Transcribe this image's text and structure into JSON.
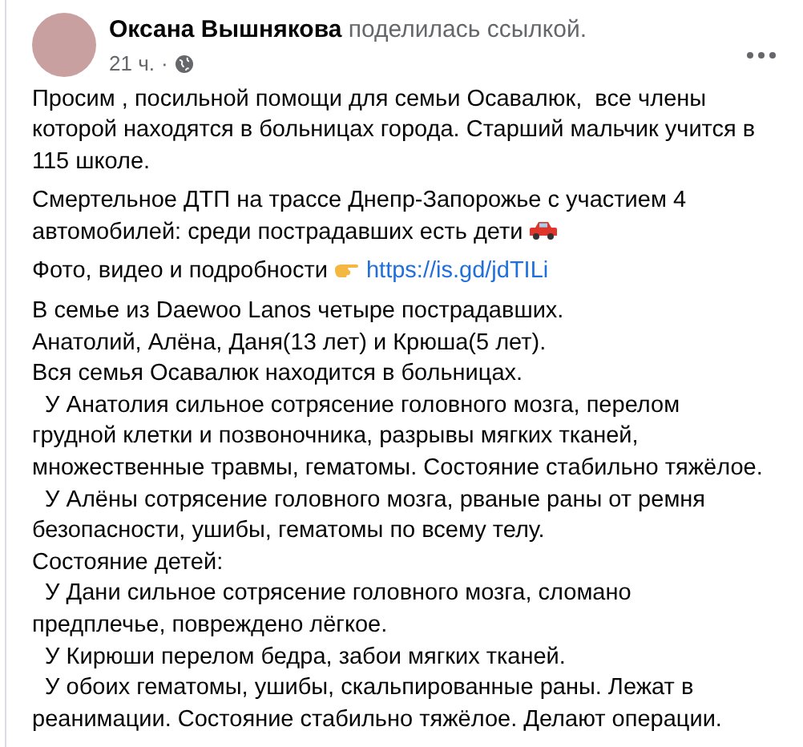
{
  "post": {
    "author": "Оксана Вышнякова",
    "action": "поделилась ссылкой.",
    "time": "21 ч.",
    "separator": "·",
    "paragraphs": [
      {
        "kind": "text",
        "lines": [
          "Просим , посильной помощи для семьи Осавалюк,  все члены",
          "которой находятся в больницах города. Старший мальчик учится в",
          "115 школе."
        ]
      },
      {
        "kind": "car",
        "lines": [
          "Смертельное ДТП на трассе Днепр-Запорожье с участием 4",
          "автомобилей: среди пострадавших есть дети"
        ]
      },
      {
        "kind": "link",
        "text": "Фото, видео и подробности",
        "url": "https://is.gd/jdTILi"
      },
      {
        "kind": "text",
        "lines": [
          "В семье из Daewoo Lanos четыре пострадавших.",
          "Анатолий, Алёна, Даня(13 лет) и Крюша(5 лет).",
          "Вся семья Осавалюк находится в больницах.",
          "  У Анатолия сильное сотрясение головного мозга, перелом",
          "грудной клетки и позвоночника, разрывы мягких тканей,",
          "множественные травмы, гематомы. Состояние стабильно тяжёлое.",
          "  У Алёны сотрясение головного мозга, рваные раны от ремня",
          "безопасности, ушибы, гематомы по всему телу.",
          "Состояние детей:",
          "  У Дани сильное сотрясение головного мозга, сломано",
          "предплечье, повреждено лёгкое.",
          "  У Кирюши перелом бедра, забои мягких тканей.",
          "  У обоих гематомы, ушибы, скальпированные раны. Лежат в",
          "реанимации. Состояние стабильно тяжёлое. Делают операции."
        ]
      }
    ]
  }
}
